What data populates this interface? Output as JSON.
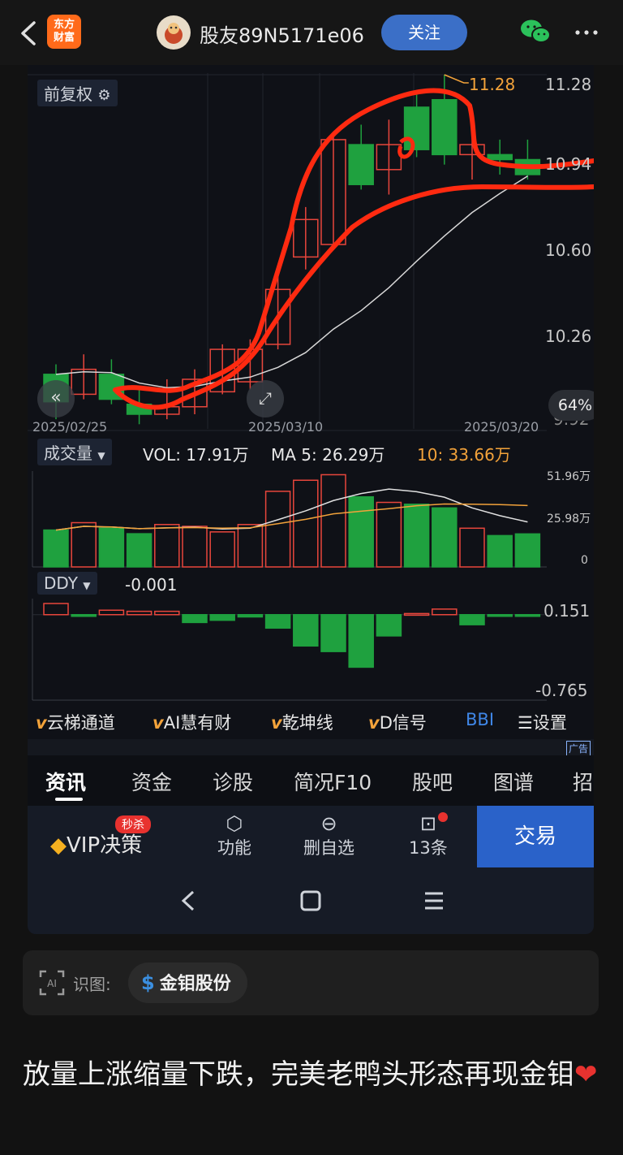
{
  "header": {
    "app_logo": "东方\n财富",
    "username": "股友89N5171e06",
    "follow_label": "关注",
    "icons": [
      "back-icon",
      "wechat-icon",
      "more-icon"
    ]
  },
  "price_panel": {
    "adjust_label": "前复权",
    "price_ticks": [
      "11.28",
      "10.94",
      "10.60",
      "10.26",
      "9.92"
    ],
    "high_marker": "11.28",
    "zoom_percent": "64%",
    "dates": [
      "2025/02/25",
      "2025/03/10",
      "2025/03/20"
    ]
  },
  "volume_panel": {
    "label": "成交量",
    "vol": "VOL: 17.91万",
    "ma5": "MA 5: 26.29万",
    "ma10": "10: 33.66万",
    "ticks": [
      "51.96万",
      "25.98万",
      "0"
    ]
  },
  "ddy_panel": {
    "label": "DDY",
    "value": "-0.001",
    "ticks": [
      "0.151",
      "-0.765"
    ]
  },
  "indicator_tools": [
    {
      "prefix": "v",
      "label": "云梯通道"
    },
    {
      "prefix": "v",
      "label": "AI慧有财"
    },
    {
      "prefix": "v",
      "label": "乾坤线"
    },
    {
      "prefix": "v",
      "label": "D信号"
    },
    {
      "prefix": "",
      "label": "BBI"
    },
    {
      "prefix": "",
      "label": "设置"
    }
  ],
  "ad_label": "广告",
  "tabs": [
    "资讯",
    "资金",
    "诊股",
    "简况F10",
    "股吧",
    "图谱",
    "招"
  ],
  "bottom_bar": {
    "vip_label": "VIP决策",
    "vip_badge": "秒杀",
    "function_label": "功能",
    "remove_label": "删自选",
    "ask_label": "13条",
    "trade_label": "交易"
  },
  "recognition": {
    "label": "识图:",
    "stock_name": "金钼股份"
  },
  "post_text": "放量上涨缩量下跌，完美老鸭头形态再现金钼",
  "chart_data": {
    "type": "candlestick",
    "candles": [
      {
        "o": 9.97,
        "c": 10.08,
        "h": 10.12,
        "l": 9.9,
        "up": false
      },
      {
        "o": 10.0,
        "c": 10.1,
        "h": 10.16,
        "l": 9.98,
        "up": true
      },
      {
        "o": 9.98,
        "c": 10.08,
        "h": 10.14,
        "l": 9.96,
        "up": false
      },
      {
        "o": 9.96,
        "c": 9.92,
        "h": 10.02,
        "l": 9.88,
        "up": false
      },
      {
        "o": 9.92,
        "c": 9.95,
        "h": 10.06,
        "l": 9.9,
        "up": true
      },
      {
        "o": 9.95,
        "c": 10.06,
        "h": 10.1,
        "l": 9.92,
        "up": true
      },
      {
        "o": 10.01,
        "c": 10.18,
        "h": 10.2,
        "l": 10.0,
        "up": true
      },
      {
        "o": 10.05,
        "c": 10.18,
        "h": 10.22,
        "l": 10.02,
        "up": true
      },
      {
        "o": 10.2,
        "c": 10.42,
        "h": 10.5,
        "l": 10.18,
        "up": true
      },
      {
        "o": 10.55,
        "c": 10.7,
        "h": 10.75,
        "l": 10.5,
        "up": true
      },
      {
        "o": 10.6,
        "c": 11.02,
        "h": 11.05,
        "l": 10.58,
        "up": true
      },
      {
        "o": 11.0,
        "c": 10.84,
        "h": 11.08,
        "l": 10.82,
        "up": false
      },
      {
        "o": 10.9,
        "c": 11.0,
        "h": 11.1,
        "l": 10.8,
        "up": true
      },
      {
        "o": 11.15,
        "c": 10.98,
        "h": 11.2,
        "l": 10.95,
        "up": false
      },
      {
        "o": 11.18,
        "c": 10.96,
        "h": 11.28,
        "l": 10.92,
        "up": false
      },
      {
        "o": 10.96,
        "c": 11.0,
        "h": 11.04,
        "l": 10.86,
        "up": true
      },
      {
        "o": 10.96,
        "c": 10.94,
        "h": 11.02,
        "l": 10.88,
        "up": false
      },
      {
        "o": 10.94,
        "c": 10.88,
        "h": 11.02,
        "l": 10.86,
        "up": false
      }
    ],
    "volume": [
      20,
      24,
      21,
      18,
      23,
      22,
      19,
      23,
      41,
      47,
      50,
      38,
      35,
      34,
      32,
      21,
      17,
      17.91
    ],
    "ddy": [
      0.1,
      -0.01,
      0.04,
      0.03,
      0.03,
      -0.07,
      -0.05,
      -0.02,
      -0.12,
      -0.28,
      -0.33,
      -0.47,
      -0.19,
      0.01,
      0.05,
      -0.09,
      -0.005,
      -0.001
    ],
    "price_range": [
      9.92,
      11.28
    ],
    "volume_range": [
      0,
      51.96
    ],
    "ddy_range": [
      -0.765,
      0.151
    ]
  }
}
